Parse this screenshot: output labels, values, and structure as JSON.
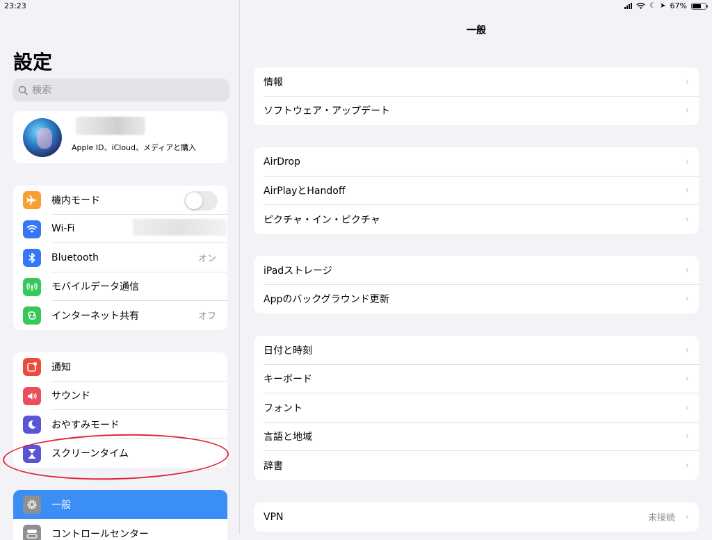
{
  "status": {
    "time": "23:23",
    "battery": "67%",
    "battery_level": 0.67
  },
  "sidebar": {
    "title": "設定",
    "search_placeholder": "検索",
    "profile_subtitle": "Apple ID、iCloud、メディアと購入",
    "connectivity": [
      {
        "label": "機内モード",
        "icon": "airplane-icon",
        "color": "#f7a130",
        "value": "",
        "toggle": false
      },
      {
        "label": "Wi-Fi",
        "icon": "wifi-icon",
        "color": "#3478f6",
        "value": ""
      },
      {
        "label": "Bluetooth",
        "icon": "bluetooth-icon",
        "color": "#3478f6",
        "value": "オン"
      },
      {
        "label": "モバイルデータ通信",
        "icon": "antenna-icon",
        "color": "#34c759",
        "value": ""
      },
      {
        "label": "インターネット共有",
        "icon": "hotspot-icon",
        "color": "#34c759",
        "value": "オフ"
      }
    ],
    "notifications": [
      {
        "label": "通知",
        "icon": "notification-icon",
        "color": "#eb4d3d"
      },
      {
        "label": "サウンド",
        "icon": "speaker-icon",
        "color": "#eb4d5c"
      },
      {
        "label": "おやすみモード",
        "icon": "moon-icon",
        "color": "#5856d6"
      },
      {
        "label": "スクリーンタイム",
        "icon": "hourglass-icon",
        "color": "#5856d6"
      }
    ],
    "general": [
      {
        "label": "一般",
        "icon": "gear-icon",
        "color": "#8e8e93",
        "selected": true
      },
      {
        "label": "コントロールセンター",
        "icon": "switches-icon",
        "color": "#8e8e93"
      }
    ]
  },
  "main": {
    "title": "一般",
    "groups": [
      [
        {
          "label": "情報"
        },
        {
          "label": "ソフトウェア・アップデート"
        }
      ],
      [
        {
          "label": "AirDrop"
        },
        {
          "label": "AirPlayとHandoff"
        },
        {
          "label": "ピクチャ・イン・ピクチャ"
        }
      ],
      [
        {
          "label": "iPadストレージ"
        },
        {
          "label": "Appのバックグラウンド更新"
        }
      ],
      [
        {
          "label": "日付と時刻"
        },
        {
          "label": "キーボード"
        },
        {
          "label": "フォント"
        },
        {
          "label": "言語と地域"
        },
        {
          "label": "辞書"
        }
      ],
      [
        {
          "label": "VPN",
          "value": "未接続"
        }
      ]
    ]
  }
}
